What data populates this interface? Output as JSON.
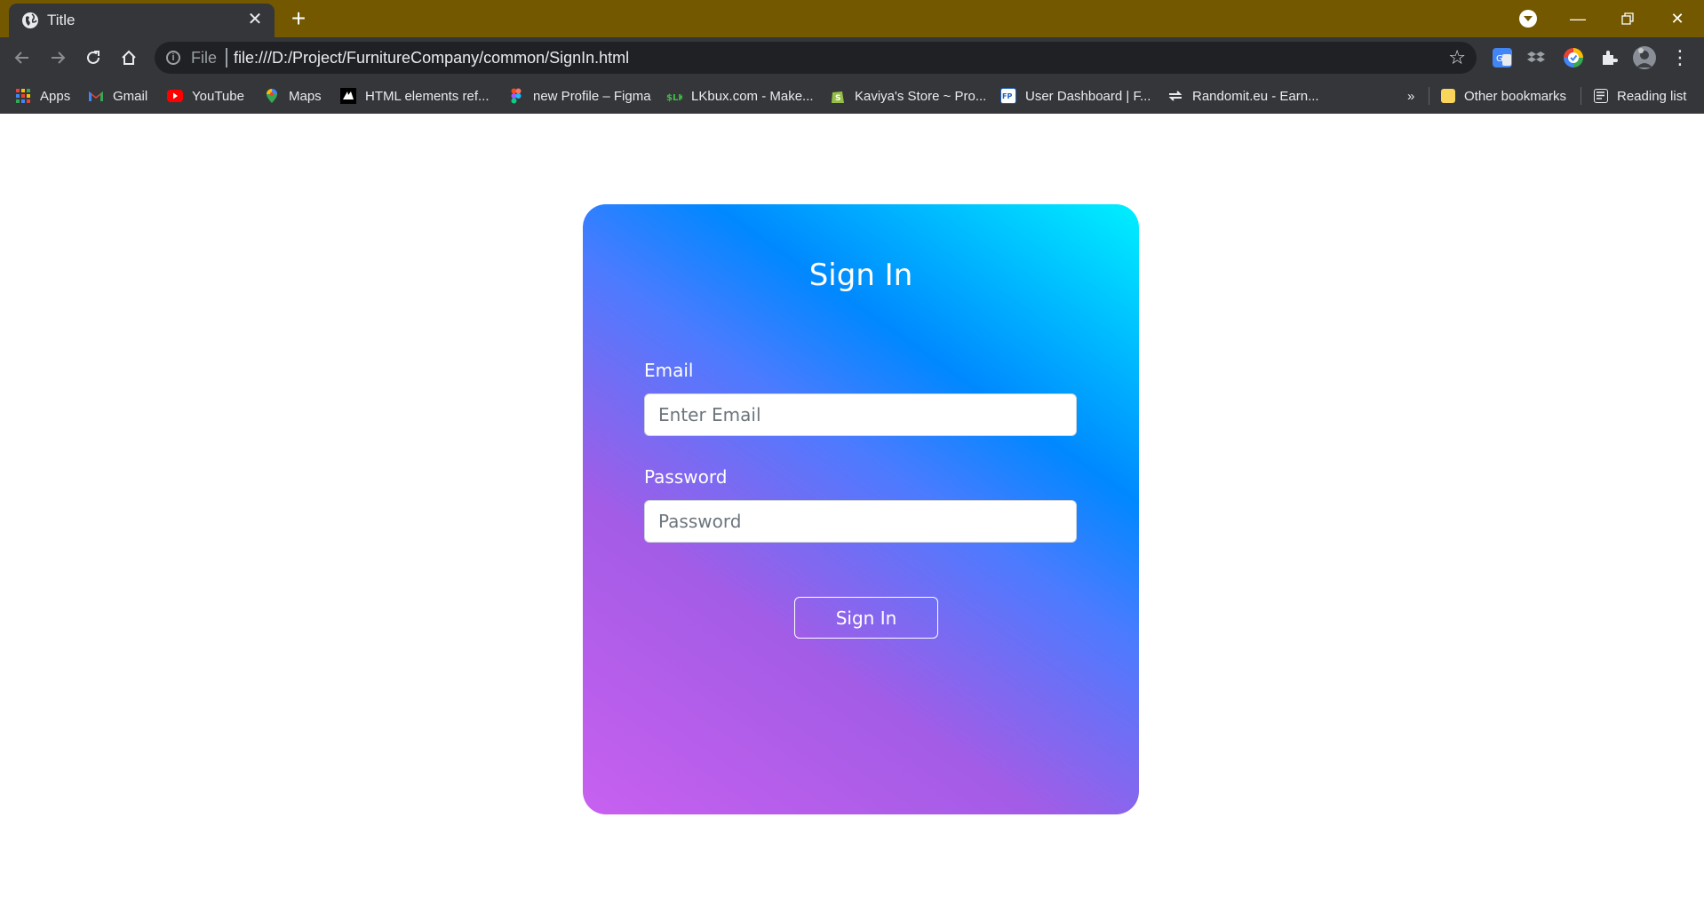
{
  "browser": {
    "tab": {
      "title": "Title"
    },
    "address": {
      "scheme": "File",
      "url": "file:///D:/Project/FurnitureCompany/common/SignIn.html"
    },
    "bookmarks": [
      {
        "label": "Apps",
        "icon": "apps-grid-icon"
      },
      {
        "label": "Gmail",
        "icon": "gmail-icon"
      },
      {
        "label": "YouTube",
        "icon": "youtube-icon"
      },
      {
        "label": "Maps",
        "icon": "maps-icon"
      },
      {
        "label": "HTML elements ref...",
        "icon": "mdn-icon"
      },
      {
        "label": "new Profile – Figma",
        "icon": "figma-icon"
      },
      {
        "label": "LKbux.com - Make...",
        "icon": "lkbux-icon"
      },
      {
        "label": "Kaviya's Store ~ Pro...",
        "icon": "shopify-icon"
      },
      {
        "label": "User Dashboard | F...",
        "icon": "fp-icon"
      },
      {
        "label": "Randomit.eu - Earn...",
        "icon": "randomit-icon"
      }
    ],
    "overflow_label": "»",
    "other_bookmarks": "Other bookmarks",
    "reading_list": "Reading list"
  },
  "signin": {
    "title": "Sign In",
    "email": {
      "label": "Email",
      "placeholder": "Enter Email",
      "value": ""
    },
    "password": {
      "label": "Password",
      "placeholder": "Password",
      "value": ""
    },
    "submit_label": "Sign In"
  },
  "colors": {
    "tabbar": "#735800",
    "chrome": "#35363a",
    "omnibox": "#202124",
    "gradient_pink": "#c860f0",
    "gradient_purple": "#a35ce6",
    "gradient_blue": "#0088ff",
    "gradient_cyan": "#00f0ff"
  }
}
